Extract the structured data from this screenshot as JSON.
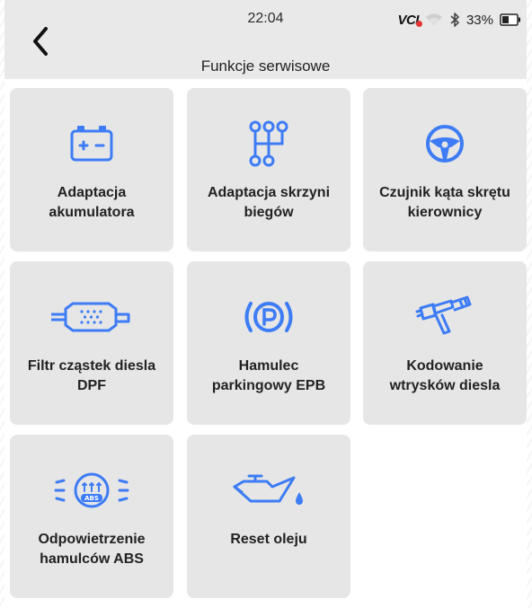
{
  "status_bar": {
    "time": "22:04",
    "vci_label": "VCI",
    "battery_percent": "33%",
    "icons": [
      "wifi-icon",
      "bluetooth-icon",
      "battery-icon"
    ]
  },
  "header": {
    "title": "Funkcje serwisowe",
    "back_icon": "chevron-left-icon"
  },
  "colors": {
    "accent": "#3d7cf5",
    "tile_bg": "#e6e6e6",
    "header_bg": "#e9e9e9",
    "vci_dot": "#e53935"
  },
  "tiles": [
    {
      "icon": "battery-icon",
      "line1": "Adaptacja",
      "line2": "akumulatora"
    },
    {
      "icon": "gear-shift-icon",
      "line1": "Adaptacja skrzyni",
      "line2": "biegów"
    },
    {
      "icon": "steering-wheel-icon",
      "line1": "Czujnik kąta skrętu",
      "line2": "kierownicy"
    },
    {
      "icon": "dpf-filter-icon",
      "line1": "Filtr cząstek diesla",
      "line2": "DPF"
    },
    {
      "icon": "parking-brake-icon",
      "line1": "Hamulec",
      "line2": "parkingowy EPB"
    },
    {
      "icon": "injector-icon",
      "line1": "Kodowanie",
      "line2": "wtrysków diesla"
    },
    {
      "icon": "abs-icon",
      "line1": "Odpowietrzenie",
      "line2": "hamulców ABS"
    },
    {
      "icon": "oil-can-icon",
      "line1": "Reset oleju",
      "line2": ""
    }
  ]
}
